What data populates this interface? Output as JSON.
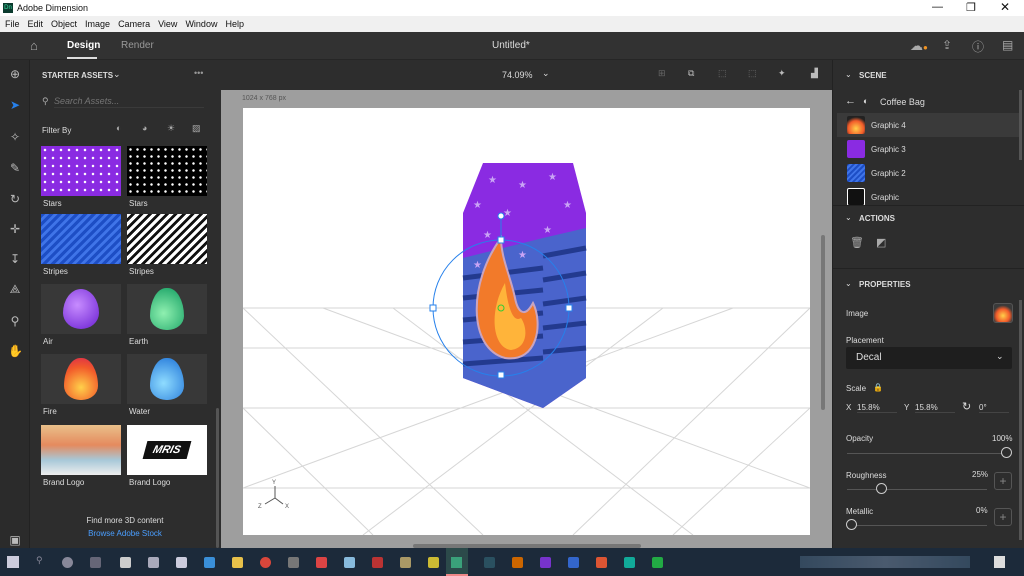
{
  "window": {
    "title": "Adobe Dimension",
    "app_badge": "Dn"
  },
  "menu": [
    "File",
    "Edit",
    "Object",
    "Image",
    "Camera",
    "View",
    "Window",
    "Help"
  ],
  "header": {
    "tabs": [
      "Design",
      "Render"
    ],
    "active_tab": "Design",
    "document_title": "Untitled*"
  },
  "canvas": {
    "zoom": "74.09%",
    "size_label": "1024 x 768 px",
    "axes": [
      "Y",
      "Z",
      "X"
    ]
  },
  "assets": {
    "title": "STARTER ASSETS",
    "search_placeholder": "Search Assets...",
    "filter_label": "Filter By",
    "items": [
      {
        "label": "Stars",
        "kind": "purple-stars"
      },
      {
        "label": "Stars",
        "kind": "black-stars"
      },
      {
        "label": "Stripes",
        "kind": "blue-stripes"
      },
      {
        "label": "Stripes",
        "kind": "bw-stripes"
      },
      {
        "label": "Air",
        "kind": "air"
      },
      {
        "label": "Earth",
        "kind": "earth"
      },
      {
        "label": "Fire",
        "kind": "fire"
      },
      {
        "label": "Water",
        "kind": "water"
      },
      {
        "label": "Brand Logo",
        "kind": "brush"
      },
      {
        "label": "Brand Logo",
        "kind": "mris"
      }
    ],
    "footer_text": "Find more 3D content",
    "footer_link": "Browse Adobe Stock",
    "logo_text": "MRIS"
  },
  "scene": {
    "title": "SCENE",
    "parent": "Coffee Bag",
    "items": [
      {
        "label": "Graphic 4",
        "selected": true
      },
      {
        "label": "Graphic 3"
      },
      {
        "label": "Graphic 2"
      },
      {
        "label": "Graphic"
      }
    ]
  },
  "actions": {
    "title": "ACTIONS"
  },
  "properties": {
    "title": "PROPERTIES",
    "image_label": "Image",
    "placement_label": "Placement",
    "placement_value": "Decal",
    "scale_label": "Scale",
    "x_label": "X",
    "x_value": "15.8%",
    "y_label": "Y",
    "y_value": "15.8%",
    "rotation": "0°",
    "opacity_label": "Opacity",
    "opacity_value": "100%",
    "opacity": 100,
    "roughness_label": "Roughness",
    "roughness_value": "25%",
    "roughness": 25,
    "metallic_label": "Metallic",
    "metallic_value": "0%",
    "metallic": 0
  },
  "colors": {
    "accent": "#2680eb",
    "purple": "#8a2be2",
    "stripe_blue": "#3f5fc8"
  }
}
